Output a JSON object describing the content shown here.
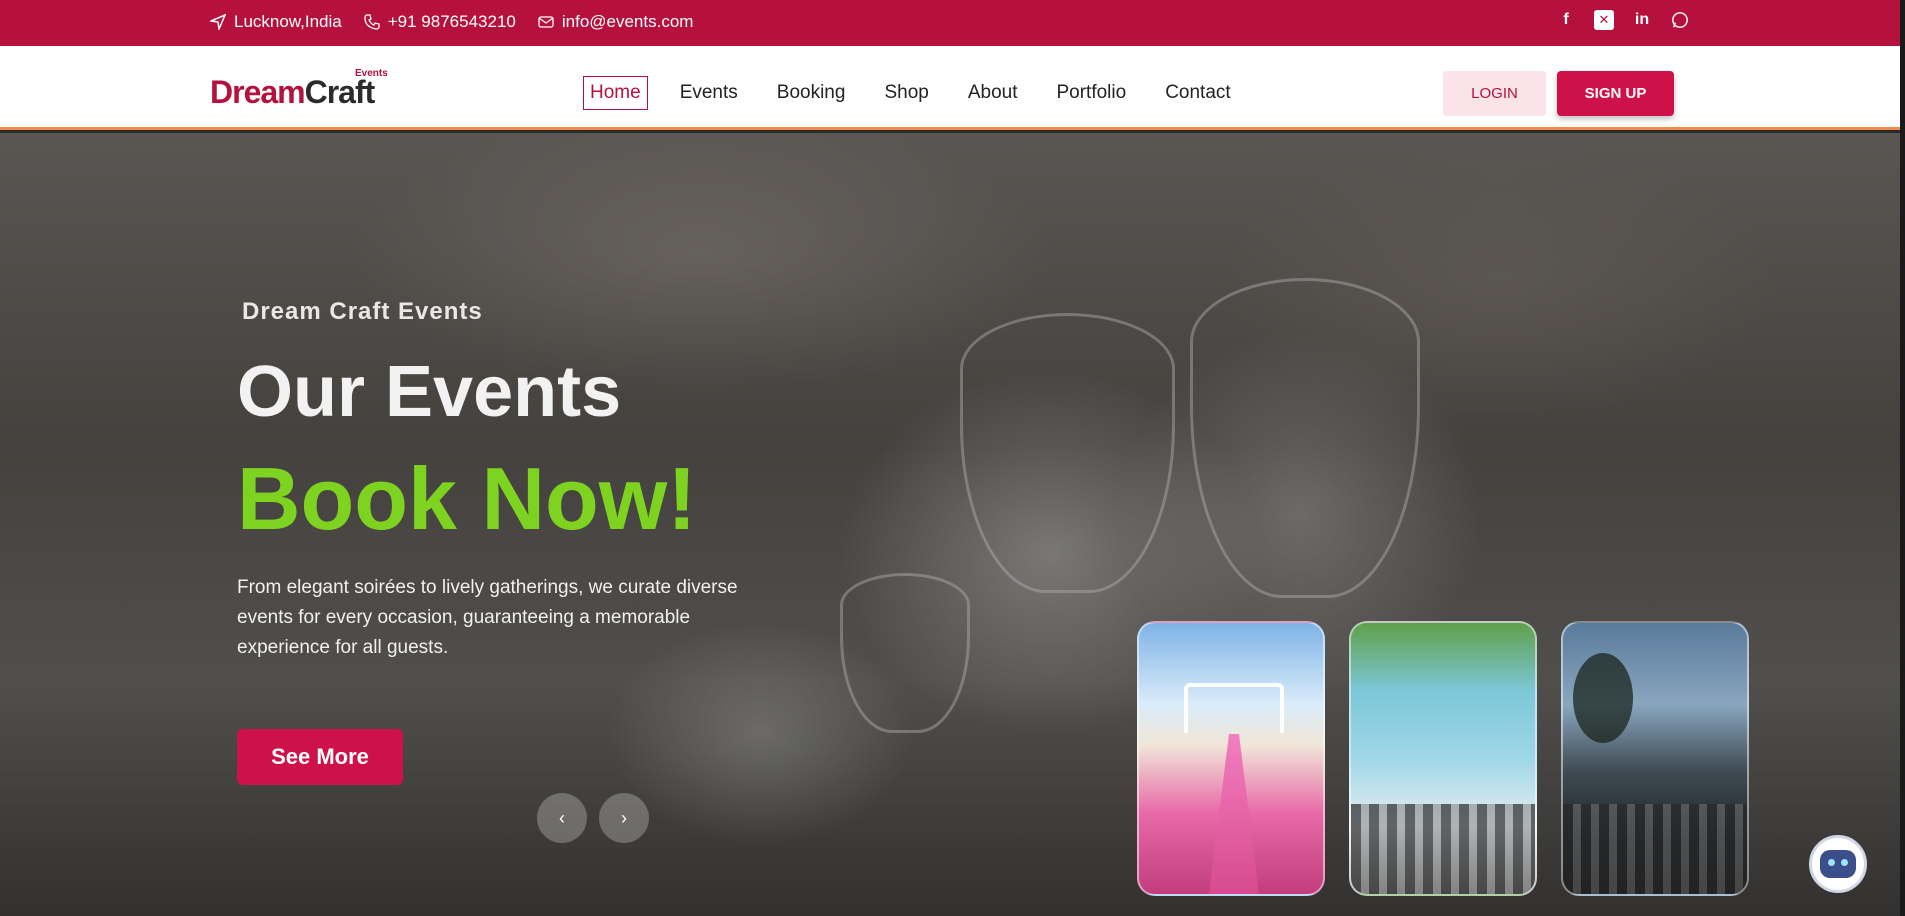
{
  "topbar": {
    "location": "Lucknow,India",
    "phone": "+91 9876543210",
    "email": "info@events.com",
    "social": [
      "facebook-icon",
      "x-icon",
      "linkedin-icon",
      "whatsapp-icon"
    ]
  },
  "nav": {
    "logo_word1": "Dream",
    "logo_word2": "Craft",
    "logo_tag": "Events",
    "items": [
      "Home",
      "Events",
      "Booking",
      "Shop",
      "About",
      "Portfolio",
      "Contact"
    ],
    "active": "Home",
    "login_label": "LOGIN",
    "signup_label": "SIGN UP"
  },
  "hero": {
    "kicker": "Dream Craft Events",
    "title": "Our Events",
    "title_highlight": "Book Now!",
    "description": "From elegant soirées to lively gatherings, we curate diverse events for every occasion, guaranteeing a memorable experience for all guests.",
    "cta_label": "See More",
    "prev_icon": "‹",
    "next_icon": "›"
  },
  "colors": {
    "brand": "#b5113c",
    "accent_green": "#7ed321",
    "signup": "#cf1149"
  }
}
